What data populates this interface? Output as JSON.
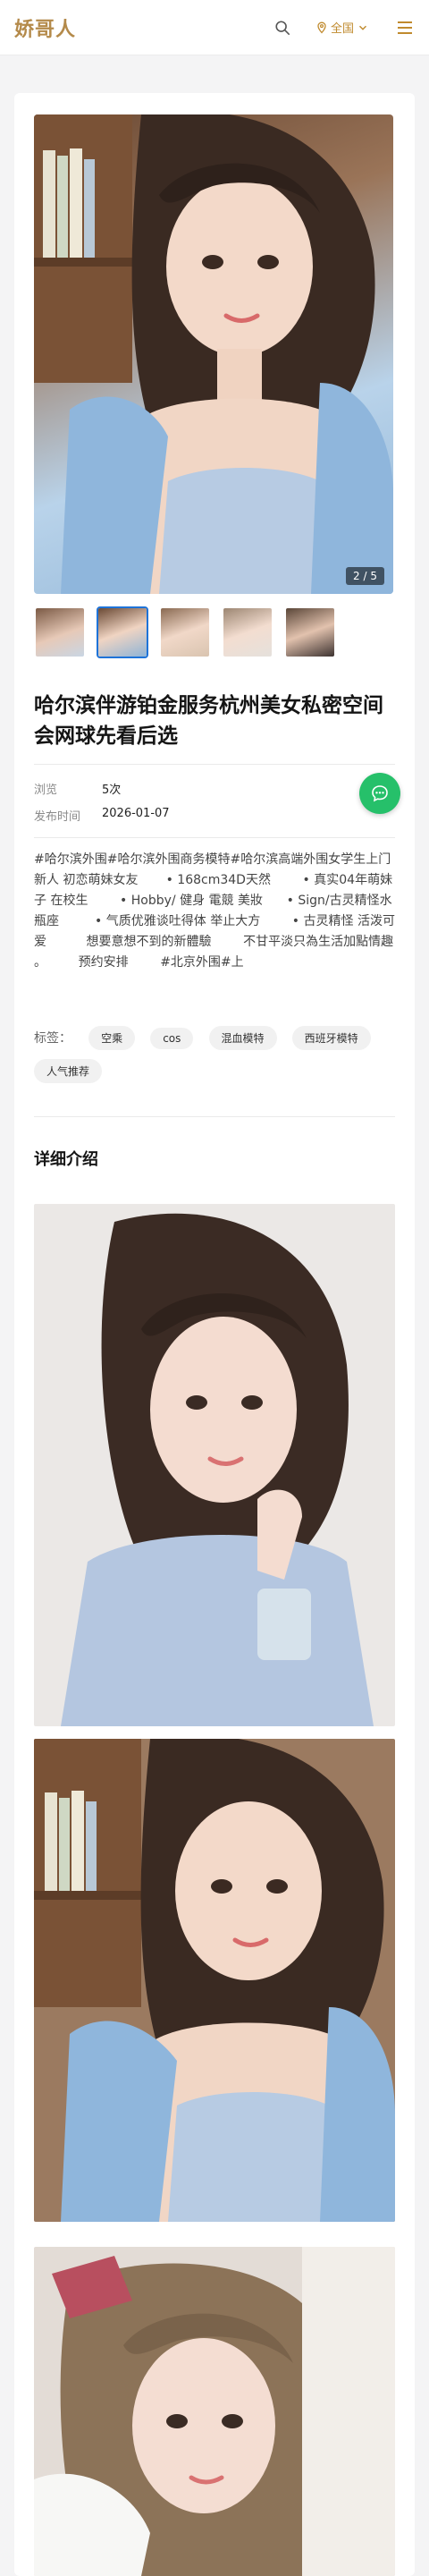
{
  "header": {
    "logo": "娇哥人",
    "region_label": "全国",
    "icons": {
      "search": "search-icon",
      "location": "location-pin-icon",
      "dropdown": "chevron-down-icon",
      "menu": "hamburger-menu-icon"
    },
    "accent_color": "#c08a2d"
  },
  "gallery": {
    "counter": "2 / 5",
    "thumb_count": 5,
    "active_index": 1
  },
  "listing": {
    "title": "哈尔滨伴游铂金服务杭州美女私密空间会网球先看后选",
    "meta": [
      {
        "key": "浏览",
        "value": "5次"
      },
      {
        "key": "发布时间",
        "value": "2026-01-07"
      }
    ],
    "description": "#哈尔滨外围#哈尔滨外围商务模特#哈尔滨高端外围女学生上门      新人 初恋萌妹女友       • 168cm34D天然        • 真实04年萌妹子 在校生        • Hobby/ 健身 電競 美妝      • Sign/古灵精怪水瓶座         • 气质优雅谈吐得体 举止大方        • 古灵精怪 活泼可爱          想要意想不到的新體驗        不甘平淡只為生活加點情趣 。        预约安排        #北京外围#上",
    "tags_label": "标签：",
    "tags": [
      "空乘",
      "cos",
      "混血模特",
      "西班牙模特",
      "人气推荐"
    ]
  },
  "details": {
    "section_title": "详细介绍"
  },
  "float_button": {
    "icon": "chat-bubble-icon",
    "color": "#26c06a"
  }
}
